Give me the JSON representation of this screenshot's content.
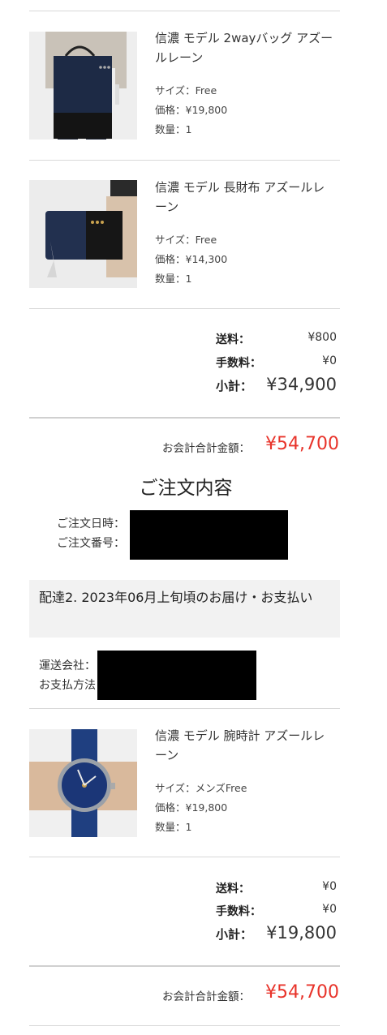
{
  "items": [
    {
      "name": "信濃 モデル 2wayバッグ アズールレーン",
      "size": "サイズ：Free",
      "price": "価格：¥19,800",
      "qty": "数量：1",
      "image": "bag-photo"
    },
    {
      "name": "信濃 モデル 長財布 アズールレーン",
      "size": "サイズ：Free",
      "price": "価格：¥14,300",
      "qty": "数量：1",
      "image": "wallet-photo"
    },
    {
      "name": "信濃 モデル 腕時計 アズールレーン",
      "size": "サイズ：メンズFree",
      "price": "価格：¥19,800",
      "qty": "数量：1",
      "image": "watch-photo"
    }
  ],
  "summary1": {
    "shipping_label": "送料：",
    "shipping": "¥800",
    "fee_label": "手数料：",
    "fee": "¥0",
    "subtotal_label": "小計：",
    "subtotal": "¥34,900"
  },
  "total1": {
    "label": "お会計合計金額：",
    "value": "¥54,700"
  },
  "order": {
    "title": "ご注文内容",
    "date_label": "ご注文日時：",
    "number_label": "ご注文番号："
  },
  "delivery": {
    "heading": "配達2. 2023年06月上旬頃のお届け・お支払い",
    "carrier_label": "運送会社：",
    "payment_label": "お支払方法"
  },
  "summary2": {
    "shipping_label": "送料：",
    "shipping": "¥0",
    "fee_label": "手数料：",
    "fee": "¥0",
    "subtotal_label": "小計：",
    "subtotal": "¥19,800"
  },
  "total2": {
    "label": "お会計合計金額：",
    "value": "¥54,700"
  },
  "colors": {
    "accent_red": "#e8332a",
    "divider": "#d8d8d8",
    "delivery_bg": "#f2f2f2"
  }
}
